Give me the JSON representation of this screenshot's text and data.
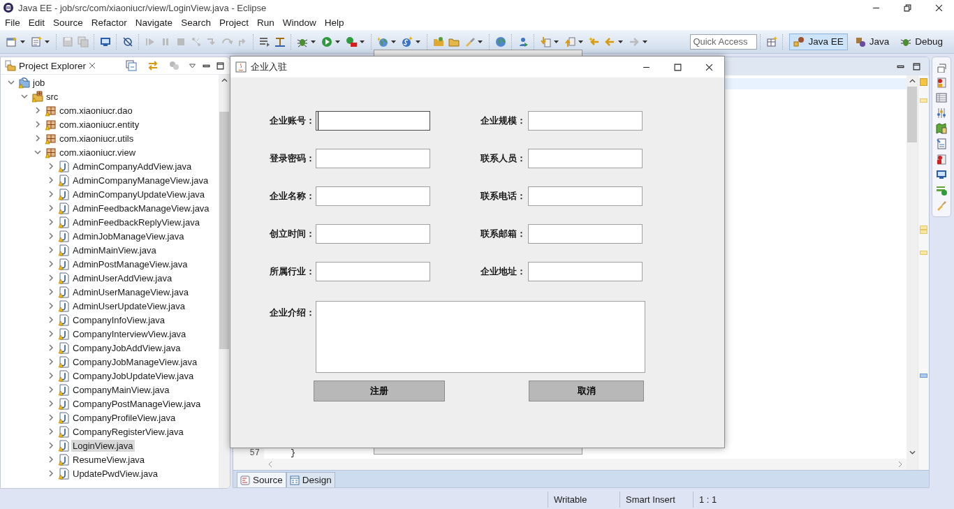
{
  "window": {
    "title": "Java EE - job/src/com/xiaoniucr/view/LoginView.java - Eclipse"
  },
  "menu": [
    "File",
    "Edit",
    "Source",
    "Refactor",
    "Navigate",
    "Search",
    "Project",
    "Run",
    "Window",
    "Help"
  ],
  "toolbar": {
    "quick_access": {
      "placeholder": "Quick Access"
    },
    "perspectives": [
      {
        "label": "Java EE",
        "selected": true
      },
      {
        "label": "Java",
        "selected": false
      },
      {
        "label": "Debug",
        "selected": false
      }
    ]
  },
  "project_explorer": {
    "title": "Project Explorer",
    "tree": [
      {
        "label": "job",
        "kind": "project",
        "expanded": true,
        "selected": false,
        "children": [
          {
            "label": "src",
            "kind": "folder",
            "expanded": true,
            "selected": false,
            "children": [
              {
                "label": "com.xiaoniucr.dao",
                "kind": "package",
                "expanded": false,
                "selected": false
              },
              {
                "label": "com.xiaoniucr.entity",
                "kind": "package",
                "expanded": false,
                "selected": false
              },
              {
                "label": "com.xiaoniucr.utils",
                "kind": "package",
                "expanded": false,
                "selected": false
              },
              {
                "label": "com.xiaoniucr.view",
                "kind": "package",
                "expanded": true,
                "selected": false,
                "children": [
                  {
                    "label": "AdminCompanyAddView.java",
                    "kind": "file",
                    "expanded": false,
                    "selected": false
                  },
                  {
                    "label": "AdminCompanyManageView.java",
                    "kind": "file",
                    "expanded": false,
                    "selected": false
                  },
                  {
                    "label": "AdminCompanyUpdateView.java",
                    "kind": "file",
                    "expanded": false,
                    "selected": false
                  },
                  {
                    "label": "AdminFeedbackManageView.java",
                    "kind": "file",
                    "expanded": false,
                    "selected": false
                  },
                  {
                    "label": "AdminFeedbackReplyView.java",
                    "kind": "file",
                    "expanded": false,
                    "selected": false
                  },
                  {
                    "label": "AdminJobManageView.java",
                    "kind": "file",
                    "expanded": false,
                    "selected": false
                  },
                  {
                    "label": "AdminMainView.java",
                    "kind": "file",
                    "expanded": false,
                    "selected": false
                  },
                  {
                    "label": "AdminPostManageView.java",
                    "kind": "file",
                    "expanded": false,
                    "selected": false
                  },
                  {
                    "label": "AdminUserAddView.java",
                    "kind": "file",
                    "expanded": false,
                    "selected": false
                  },
                  {
                    "label": "AdminUserManageView.java",
                    "kind": "file",
                    "expanded": false,
                    "selected": false
                  },
                  {
                    "label": "AdminUserUpdateView.java",
                    "kind": "file",
                    "expanded": false,
                    "selected": false
                  },
                  {
                    "label": "CompanyInfoView.java",
                    "kind": "file",
                    "expanded": false,
                    "selected": false
                  },
                  {
                    "label": "CompanyInterviewView.java",
                    "kind": "file",
                    "expanded": false,
                    "selected": false
                  },
                  {
                    "label": "CompanyJobAddView.java",
                    "kind": "file",
                    "expanded": false,
                    "selected": false
                  },
                  {
                    "label": "CompanyJobManageView.java",
                    "kind": "file",
                    "expanded": false,
                    "selected": false
                  },
                  {
                    "label": "CompanyJobUpdateView.java",
                    "kind": "file",
                    "expanded": false,
                    "selected": false
                  },
                  {
                    "label": "CompanyMainView.java",
                    "kind": "file",
                    "expanded": false,
                    "selected": false
                  },
                  {
                    "label": "CompanyPostManageView.java",
                    "kind": "file",
                    "expanded": false,
                    "selected": false
                  },
                  {
                    "label": "CompanyProfileView.java",
                    "kind": "file",
                    "expanded": false,
                    "selected": false
                  },
                  {
                    "label": "CompanyRegisterView.java",
                    "kind": "file",
                    "expanded": false,
                    "selected": false
                  },
                  {
                    "label": "LoginView.java",
                    "kind": "file",
                    "expanded": false,
                    "selected": true
                  },
                  {
                    "label": "ResumeView.java",
                    "kind": "file",
                    "expanded": false,
                    "selected": false
                  },
                  {
                    "label": "UpdatePwdView.java",
                    "kind": "file",
                    "expanded": false,
                    "selected": false
                  }
                ]
              }
            ]
          }
        ]
      }
    ]
  },
  "editor": {
    "lines": [
      {
        "number": "57",
        "code": "}"
      }
    ],
    "tabs": [
      {
        "label": "Source",
        "selected": true
      },
      {
        "label": "Design",
        "selected": false
      }
    ]
  },
  "status_bar": [
    "Writable",
    "Smart Insert",
    "1 : 1"
  ],
  "dialog": {
    "title": "企业入驻",
    "fields": [
      {
        "label": "企业账号：",
        "focused": true
      },
      {
        "label": "企业规模：",
        "focused": false
      },
      {
        "label": "登录密码：",
        "focused": false
      },
      {
        "label": "联系人员：",
        "focused": false
      },
      {
        "label": "企业名称：",
        "focused": false
      },
      {
        "label": "联系电话：",
        "focused": false
      },
      {
        "label": "创立时间：",
        "focused": false
      },
      {
        "label": "联系邮箱：",
        "focused": false
      },
      {
        "label": "所属行业：",
        "focused": false
      },
      {
        "label": "企业地址：",
        "focused": false
      }
    ],
    "intro": {
      "label": "企业介绍："
    },
    "buttons": [
      "注册",
      "取消"
    ]
  }
}
